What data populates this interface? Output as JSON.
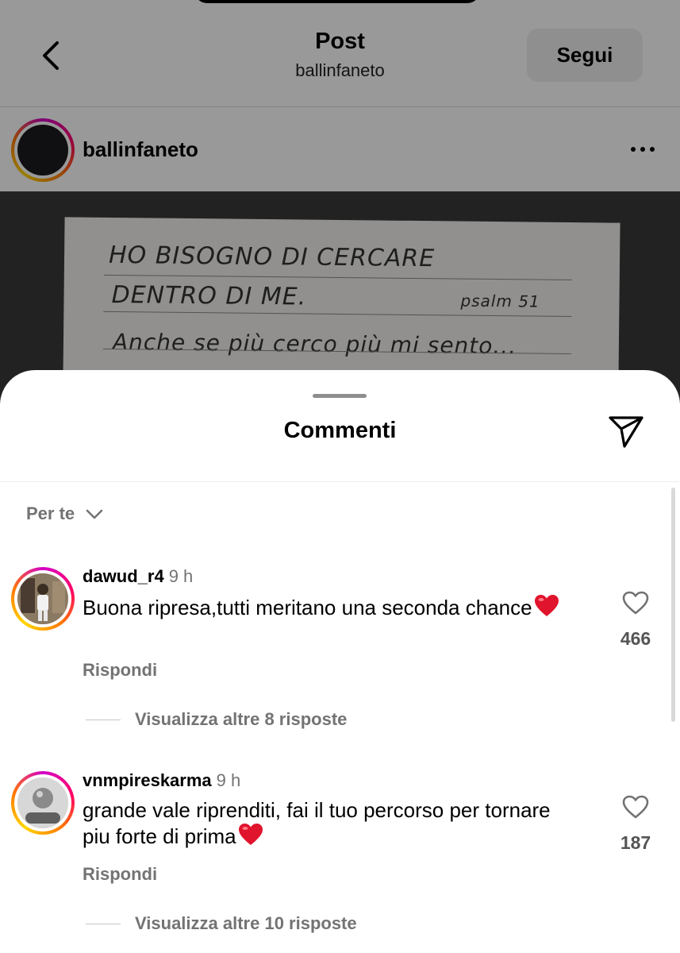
{
  "header": {
    "title": "Post",
    "subtitle": "ballinfaneto",
    "follow_label": "Segui"
  },
  "post": {
    "author": "ballinfaneto",
    "handwriting": {
      "line1": "HO BISOGNO DI CERCARE",
      "line2": "DENTRO DI ME.",
      "ref": "psalm 51",
      "line3": "Anche se più cerco più mi sento..."
    }
  },
  "sheet": {
    "title": "Commenti",
    "sort_label": "Per te"
  },
  "comments": [
    {
      "user": "dawud_r4",
      "time": "9 h",
      "text": "Buona ripresa,tutti meritano una seconda chance",
      "reply_label": "Rispondi",
      "likes": "466",
      "more_replies": "Visualizza altre 8 risposte"
    },
    {
      "user": "vnmpireskarma",
      "time": "9 h",
      "text": "grande vale riprenditi, fai il tuo percorso per tornare piu forte di prima",
      "reply_label": "Rispondi",
      "likes": "187",
      "more_replies": "Visualizza altre 10 risposte"
    }
  ],
  "icons": {
    "back": "chevron-left-icon",
    "more": "more-horizontal-icon",
    "share": "send-icon",
    "sort": "chevron-down-icon",
    "like": "heart-outline-icon",
    "emoji": "red-heart-emoji"
  },
  "colors": {
    "accent_gradient": [
      "#d300c5",
      "#ff0069",
      "#ff7a00",
      "#ffd600"
    ],
    "secondary_text": "#737373",
    "heart_emoji": "#e0142c"
  }
}
